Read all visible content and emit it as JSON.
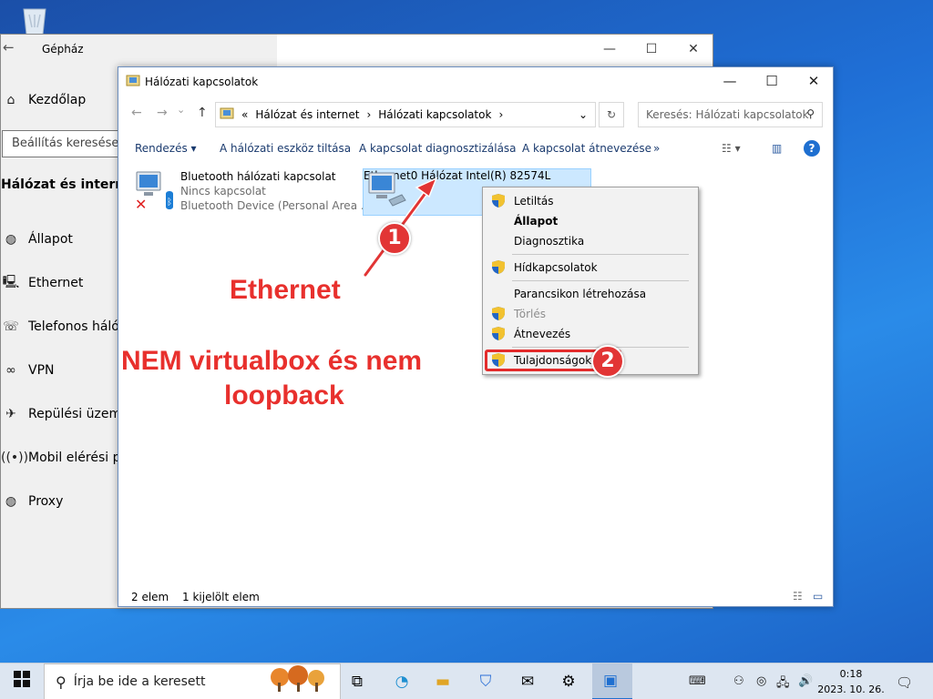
{
  "colors": {
    "accent": "#0078d7",
    "annotation": "#e8302d",
    "selection": "#cce8ff"
  },
  "settings": {
    "title": "Gépház",
    "home": "Kezdőlap",
    "search_placeholder": "Beállítás keresése",
    "section": "Hálózat és internet",
    "nav": [
      {
        "icon": "globe-icon",
        "label": "Állapot"
      },
      {
        "icon": "ethernet-icon",
        "label": "Ethernet"
      },
      {
        "icon": "dialup-icon",
        "label": "Telefonos hálóza"
      },
      {
        "icon": "vpn-icon",
        "label": "VPN"
      },
      {
        "icon": "airplane-icon",
        "label": "Repülési üzemm"
      },
      {
        "icon": "hotspot-icon",
        "label": "Mobil elérési po"
      },
      {
        "icon": "globe-icon",
        "label": "Proxy"
      }
    ]
  },
  "explorer": {
    "title": "Hálózati kapcsolatok",
    "breadcrumb": [
      "Hálózat és internet",
      "Hálózati kapcsolatok"
    ],
    "search_placeholder": "Keresés: Hálózati kapcsolatok",
    "commands": [
      "Rendezés",
      "A hálózati eszköz tiltása",
      "A kapcsolat diagnosztizálása",
      "A kapcsolat átnevezése",
      "»"
    ],
    "items": [
      {
        "name": "Bluetooth hálózati kapcsolat",
        "status": "Nincs kapcsolat",
        "device": "Bluetooth Device (Personal Area ..."
      },
      {
        "name": "Ethernet0",
        "status": "Hálózat",
        "device": "Intel(R) 82574L"
      }
    ],
    "status": {
      "count": "2 elem",
      "selected": "1 kijelölt elem"
    }
  },
  "context_menu": {
    "items": [
      {
        "label": "Letiltás",
        "shield": true
      },
      {
        "label": "Állapot",
        "bold": true
      },
      {
        "label": "Diagnosztika"
      },
      {
        "label": "Hídkapcsolatok",
        "shield": true
      },
      {
        "label": "Parancsikon létrehozása"
      },
      {
        "label": "Törlés",
        "disabled": true,
        "shield": true
      },
      {
        "label": "Átnevezés",
        "shield": true
      },
      {
        "label": "Tulajdonságok",
        "shield": true
      }
    ]
  },
  "annotations": {
    "badge1": "1",
    "badge2": "2",
    "ethernet": "Ethernet",
    "note_line1": "NEM virtualbox és nem",
    "note_line2": "loopback"
  },
  "taskbar": {
    "search_placeholder": "Írja be ide a keresett",
    "time": "0:18",
    "date": "2023. 10. 26."
  }
}
